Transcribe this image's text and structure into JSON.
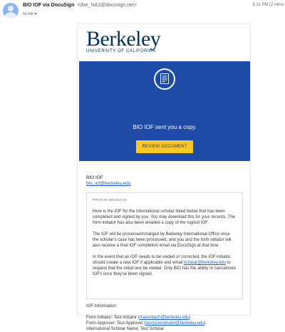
{
  "header": {
    "sender_name": "BIO IOF via DocuSign",
    "sender_email": "<dse_NA3@docusign.net>",
    "to_line": "to me ▾",
    "timestamp": "3:11 PM (2 minu"
  },
  "email": {
    "logo_word": "Berkeley",
    "logo_sub": "UNIVERSITY OF CALIFORNIA",
    "banner_text": "BIO IOF sent you a copy.",
    "review_button": "REVIEW DOCUMENT",
    "from_name": "BIO IOF",
    "from_email": "bio_iof@berkeley.edu",
    "private_message_label": "PRIVATE MESSAGE",
    "para1": "Here is the IOF for the international scholar listed below that has been completed and signed by you. You may download this for your records. The form initiator has also been emailed a copy of the signed IOF.",
    "para2": "The IOF will be processed/charged by Berkeley International Office once the scholar's case has been processed, and you and the form initiator will also receive a final IOF completion email via DocuSign at that time.",
    "para3_pre": "In the event that an IOF needs to be voided or corrected, the IOF initiator should create a new IOF if applicable and email ",
    "para3_link": "jlchalar@berkeley.edu",
    "para3_post": " to request that the initial one be voided. Only BIO has the ability to cancel/void IOFs once they've been signed.",
    "iof_info_title": "IOF Information:",
    "initiator_pre": "Form Initiator: Test Initiator (",
    "initiator_email": "mauerbach@berkeley.edu",
    "initiator_post": ")",
    "approver_pre": "Form Approver: Test Approver (",
    "approver_email": "sevscoordinator@berkeley.edu",
    "approver_post": ")",
    "scholar_line": "International Scholar Name: Test Scholar"
  },
  "colors": {
    "banner": "#1e4aa8",
    "button": "#ffc820",
    "brand": "#003262",
    "link": "#1a5fd1"
  }
}
